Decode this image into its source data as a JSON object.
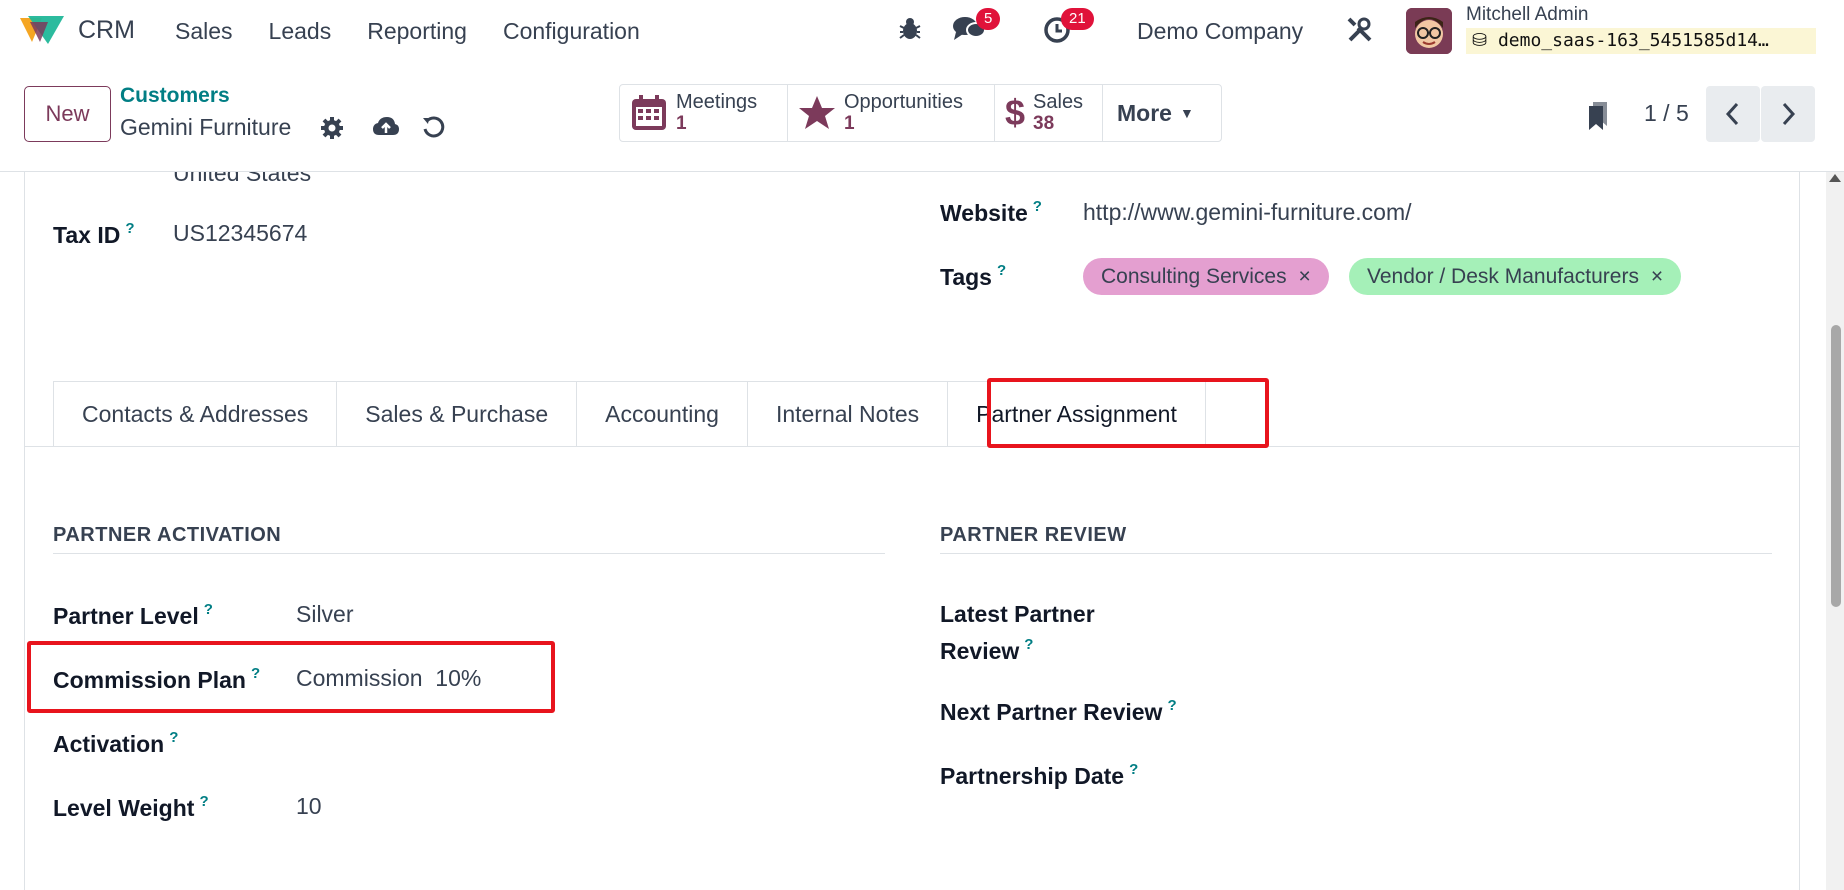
{
  "navbar": {
    "app_name": "CRM",
    "menu": [
      "Sales",
      "Leads",
      "Reporting",
      "Configuration"
    ],
    "messages_count": "5",
    "activities_count": "21",
    "company": "Demo Company",
    "user_name": "Mitchell Admin",
    "database": "demo_saas-163_5451585d14…"
  },
  "control": {
    "new_label": "New",
    "breadcrumb": "Customers",
    "record_title": "Gemini Furniture",
    "smart_buttons": [
      {
        "label": "Meetings",
        "value": "1"
      },
      {
        "label": "Opportunities",
        "value": "1"
      },
      {
        "label": "Sales",
        "value": "38"
      }
    ],
    "more_label": "More",
    "pager": "1 / 5"
  },
  "form": {
    "clipped_text": "United States",
    "tax_id_label": "Tax ID",
    "tax_id_value": "US12345674",
    "website_label": "Website",
    "website_value": "http://www.gemini-furniture.com/",
    "tags_label": "Tags",
    "tags": [
      {
        "label": "Consulting Services",
        "color": "#e49fd0"
      },
      {
        "label": "Vendor / Desk Manufacturers",
        "color": "#a5f0b8"
      }
    ],
    "help_mark": "?",
    "tabs": [
      "Contacts & Addresses",
      "Sales & Purchase",
      "Accounting",
      "Internal Notes",
      "Partner Assignment"
    ],
    "activation": {
      "title": "PARTNER ACTIVATION",
      "partner_level_label": "Partner Level",
      "partner_level_value": "Silver",
      "commission_plan_label": "Commission Plan",
      "commission_plan_value": "Commission  10%",
      "activation_label": "Activation",
      "level_weight_label": "Level Weight",
      "level_weight_value": "10"
    },
    "review": {
      "title": "PARTNER REVIEW",
      "latest_review_label_1": "Latest Partner",
      "latest_review_label_2": "Review",
      "next_review_label": "Next Partner Review",
      "partnership_date_label": "Partnership Date"
    }
  },
  "colors": {
    "brand": "#7c3a5b",
    "accent": "#017e84",
    "badge": "#e0123a",
    "highlight": "#e8141d"
  }
}
